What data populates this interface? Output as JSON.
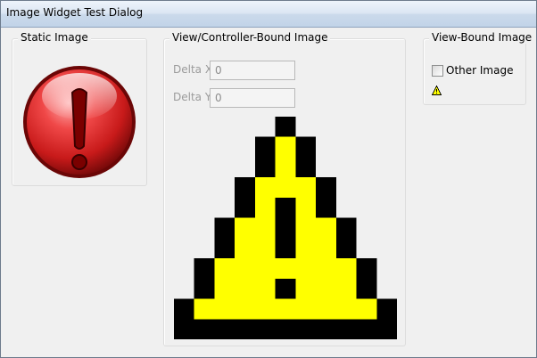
{
  "window": {
    "title": "Image Widget Test Dialog"
  },
  "static_group": {
    "title": "Static Image",
    "icon": "error-exclamation-icon"
  },
  "controller_group": {
    "title": "View/Controller-Bound Image",
    "delta_x": {
      "label": "Delta X",
      "value": "0"
    },
    "delta_y": {
      "label": "Delta Y",
      "value": "0"
    },
    "icon": "warning-icon",
    "colors": {
      "fill": "#ffff00",
      "outline": "#000000"
    }
  },
  "view_group": {
    "title": "View-Bound Image",
    "checkbox": {
      "label": "Other Image",
      "checked": false
    },
    "icon": "warning-icon"
  }
}
